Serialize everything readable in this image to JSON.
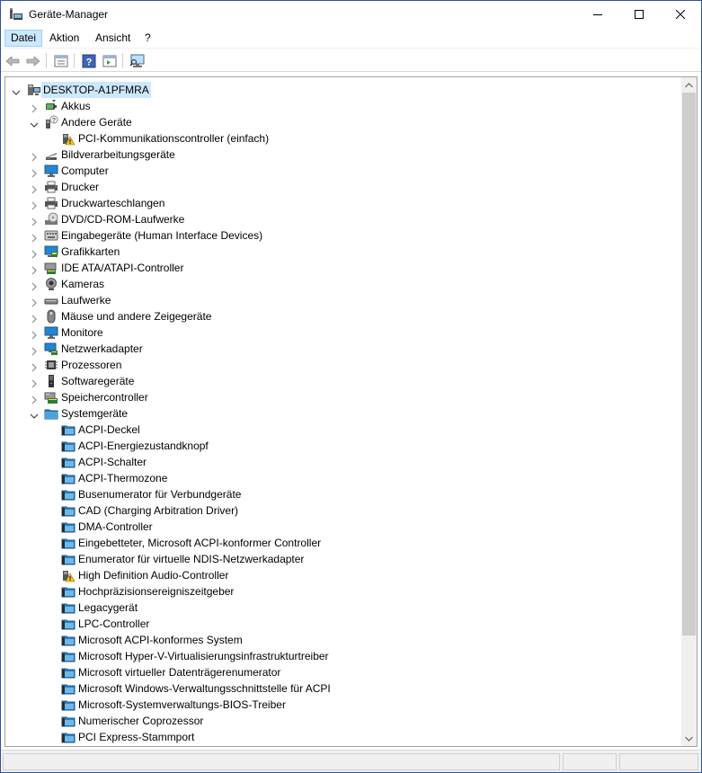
{
  "window": {
    "title": "Geräte-Manager",
    "controls": {
      "minimize": "minimize",
      "maximize": "maximize",
      "close": "close"
    }
  },
  "menu": [
    {
      "label": "Datei",
      "underline": "D",
      "active": true
    },
    {
      "label": "Aktion",
      "underline": "A",
      "active": false
    },
    {
      "label": "Ansicht",
      "underline": "n",
      "active": false
    },
    {
      "label": "?",
      "underline": "?",
      "active": false
    }
  ],
  "toolbar": [
    {
      "name": "back-button",
      "icon": "back-arrow-icon",
      "enabled": false
    },
    {
      "name": "forward-button",
      "icon": "forward-arrow-icon",
      "enabled": false
    },
    {
      "name": "properties-view-button",
      "icon": "properties-icon",
      "enabled": true
    },
    {
      "name": "help-button",
      "icon": "help-icon",
      "enabled": true
    },
    {
      "name": "details-view-button",
      "icon": "details-icon",
      "enabled": true
    },
    {
      "name": "scan-hardware-button",
      "icon": "monitor-scan-icon",
      "enabled": true
    }
  ],
  "tree": [
    {
      "label": "DESKTOP-A1PFMRA",
      "level": 0,
      "expander": "expanded",
      "icon": "computer-root-icon",
      "selected": true
    },
    {
      "label": "Akkus",
      "level": 1,
      "expander": "collapsed",
      "icon": "battery-icon"
    },
    {
      "label": "Andere Geräte",
      "level": 1,
      "expander": "expanded",
      "icon": "unknown-device-icon"
    },
    {
      "label": "PCI-Kommunikationscontroller (einfach)",
      "level": 2,
      "expander": "none",
      "icon": "warning-device-icon"
    },
    {
      "label": "Bildverarbeitungsgeräte",
      "level": 1,
      "expander": "collapsed",
      "icon": "scanner-icon"
    },
    {
      "label": "Computer",
      "level": 1,
      "expander": "collapsed",
      "icon": "monitor-icon"
    },
    {
      "label": "Drucker",
      "level": 1,
      "expander": "collapsed",
      "icon": "printer-icon"
    },
    {
      "label": "Druckwarteschlangen",
      "level": 1,
      "expander": "collapsed",
      "icon": "printer-icon"
    },
    {
      "label": "DVD/CD-ROM-Laufwerke",
      "level": 1,
      "expander": "collapsed",
      "icon": "disc-drive-icon"
    },
    {
      "label": "Eingabegeräte (Human Interface Devices)",
      "level": 1,
      "expander": "collapsed",
      "icon": "hid-icon"
    },
    {
      "label": "Grafikkarten",
      "level": 1,
      "expander": "collapsed",
      "icon": "display-adapter-icon"
    },
    {
      "label": "IDE ATA/ATAPI-Controller",
      "level": 1,
      "expander": "collapsed",
      "icon": "ide-controller-icon"
    },
    {
      "label": "Kameras",
      "level": 1,
      "expander": "collapsed",
      "icon": "camera-icon"
    },
    {
      "label": "Laufwerke",
      "level": 1,
      "expander": "collapsed",
      "icon": "drive-icon"
    },
    {
      "label": "Mäuse und andere Zeigegeräte",
      "level": 1,
      "expander": "collapsed",
      "icon": "mouse-icon"
    },
    {
      "label": "Monitore",
      "level": 1,
      "expander": "collapsed",
      "icon": "monitor-icon"
    },
    {
      "label": "Netzwerkadapter",
      "level": 1,
      "expander": "collapsed",
      "icon": "network-adapter-icon"
    },
    {
      "label": "Prozessoren",
      "level": 1,
      "expander": "collapsed",
      "icon": "processor-icon"
    },
    {
      "label": "Softwaregeräte",
      "level": 1,
      "expander": "collapsed",
      "icon": "software-device-icon"
    },
    {
      "label": "Speichercontroller",
      "level": 1,
      "expander": "collapsed",
      "icon": "storage-controller-icon"
    },
    {
      "label": "Systemgeräte",
      "level": 1,
      "expander": "expanded",
      "icon": "system-folder-icon"
    },
    {
      "label": "ACPI-Deckel",
      "level": 2,
      "expander": "none",
      "icon": "system-device-icon"
    },
    {
      "label": "ACPI-Energiezustandknopf",
      "level": 2,
      "expander": "none",
      "icon": "system-device-icon"
    },
    {
      "label": "ACPI-Schalter",
      "level": 2,
      "expander": "none",
      "icon": "system-device-icon"
    },
    {
      "label": "ACPI-Thermozone",
      "level": 2,
      "expander": "none",
      "icon": "system-device-icon"
    },
    {
      "label": "Busenumerator für Verbundgeräte",
      "level": 2,
      "expander": "none",
      "icon": "system-device-icon"
    },
    {
      "label": "CAD (Charging Arbitration Driver)",
      "level": 2,
      "expander": "none",
      "icon": "system-device-icon"
    },
    {
      "label": "DMA-Controller",
      "level": 2,
      "expander": "none",
      "icon": "system-device-icon"
    },
    {
      "label": "Eingebetteter, Microsoft ACPI-konformer Controller",
      "level": 2,
      "expander": "none",
      "icon": "system-device-icon"
    },
    {
      "label": "Enumerator für virtuelle NDIS-Netzwerkadapter",
      "level": 2,
      "expander": "none",
      "icon": "system-device-icon"
    },
    {
      "label": "High Definition Audio-Controller",
      "level": 2,
      "expander": "none",
      "icon": "warning-device-icon"
    },
    {
      "label": "Hochpräzisionsereigniszeitgeber",
      "level": 2,
      "expander": "none",
      "icon": "system-device-icon"
    },
    {
      "label": "Legacygerät",
      "level": 2,
      "expander": "none",
      "icon": "system-device-icon"
    },
    {
      "label": "LPC-Controller",
      "level": 2,
      "expander": "none",
      "icon": "system-device-icon"
    },
    {
      "label": "Microsoft ACPI-konformes System",
      "level": 2,
      "expander": "none",
      "icon": "system-device-icon"
    },
    {
      "label": "Microsoft Hyper-V-Virtualisierungsinfrastrukturtreiber",
      "level": 2,
      "expander": "none",
      "icon": "system-device-icon"
    },
    {
      "label": "Microsoft virtueller Datenträgerenumerator",
      "level": 2,
      "expander": "none",
      "icon": "system-device-icon"
    },
    {
      "label": "Microsoft Windows-Verwaltungsschnittstelle für ACPI",
      "level": 2,
      "expander": "none",
      "icon": "system-device-icon"
    },
    {
      "label": "Microsoft-Systemverwaltungs-BIOS-Treiber",
      "level": 2,
      "expander": "none",
      "icon": "system-device-icon"
    },
    {
      "label": "Numerischer Coprozessor",
      "level": 2,
      "expander": "none",
      "icon": "system-device-icon"
    },
    {
      "label": "PCI Express-Stammport",
      "level": 2,
      "expander": "none",
      "icon": "system-device-icon"
    }
  ],
  "scrollbar": {
    "thumb_fraction_start": 0.0,
    "thumb_fraction_visible": 0.85
  },
  "colors": {
    "selection": "#cce8ff",
    "accent_blue": "#1e88d4",
    "warning_yellow": "#f5c518"
  }
}
